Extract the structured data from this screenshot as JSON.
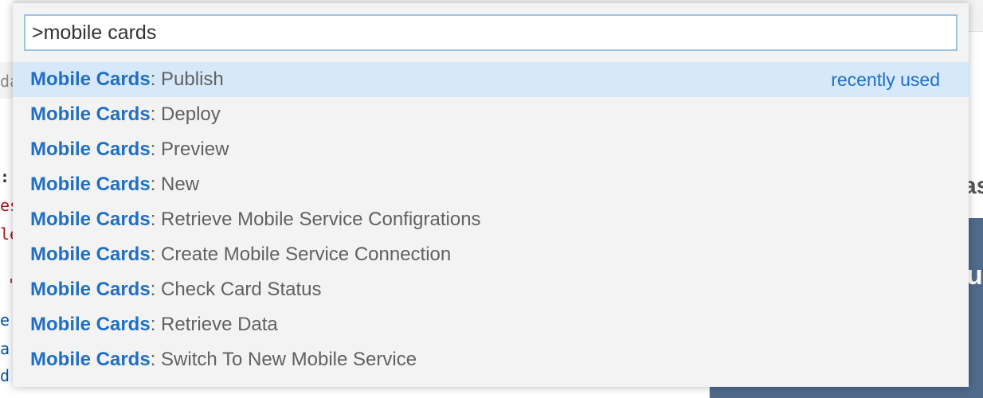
{
  "palette": {
    "input_value": ">mobile cards",
    "separator": ":",
    "items": [
      {
        "prefix": "Mobile Cards",
        "command": "Publish",
        "badge": "recently used",
        "selected": true
      },
      {
        "prefix": "Mobile Cards",
        "command": "Deploy"
      },
      {
        "prefix": "Mobile Cards",
        "command": "Preview"
      },
      {
        "prefix": "Mobile Cards",
        "command": "New"
      },
      {
        "prefix": "Mobile Cards",
        "command": "Retrieve Mobile Service Configrations"
      },
      {
        "prefix": "Mobile Cards",
        "command": "Create Mobile Service Connection"
      },
      {
        "prefix": "Mobile Cards",
        "command": "Check Card Status"
      },
      {
        "prefix": "Mobile Cards",
        "command": "Retrieve Data"
      },
      {
        "prefix": "Mobile Cards",
        "command": "Switch To New Mobile Service"
      }
    ]
  },
  "background": {
    "peek_fragments": [
      "da",
      ":",
      "es",
      "le",
      "'",
      "e'",
      "a.",
      "d'",
      "as",
      "u"
    ],
    "colors": {
      "highlight": "#1f6fc5",
      "selected_row": "#d6e8f9",
      "input_border": "#9cc3e6",
      "code_red": "#a31515",
      "code_blue": "#0451a5",
      "panel_card": "#4f6a8b"
    }
  }
}
